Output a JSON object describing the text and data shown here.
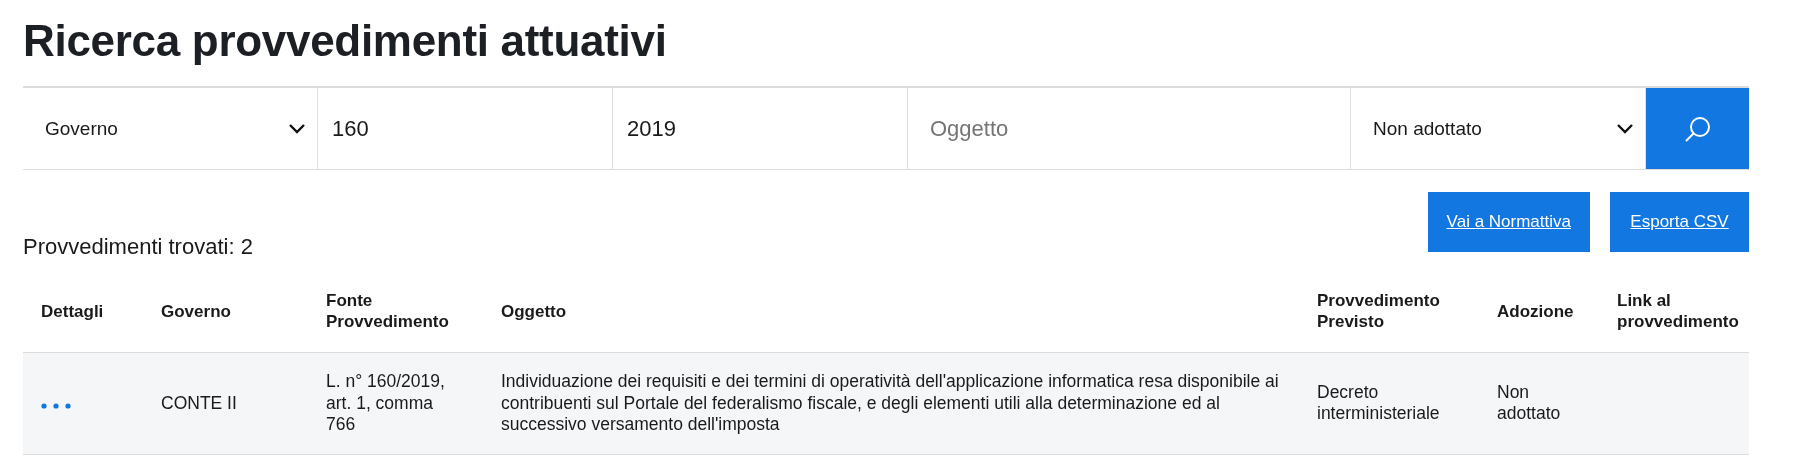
{
  "title": "Ricerca provvedimenti attuativi",
  "filters": [
    {
      "kind": "select",
      "value": "Governo"
    },
    {
      "kind": "input",
      "value": "160"
    },
    {
      "kind": "input",
      "value": "2019"
    },
    {
      "kind": "input",
      "placeholder": "Oggetto"
    },
    {
      "kind": "select",
      "value": "Non adottato"
    }
  ],
  "actions": [
    "Vai a Normattiva",
    "Esporta CSV"
  ],
  "results_count": "Provvedimenti trovati: 2",
  "table": {
    "columns": [
      "Dettagli",
      "Governo",
      "Fonte Provvedimento",
      "Oggetto",
      "Provvedimento Previsto",
      "Adozione",
      "Link al provvedimento"
    ],
    "rows": [
      {
        "governo": "CONTE II",
        "fonte": "L. n° 160/2019, art. 1, comma 766",
        "oggetto": "Individuazione dei requisiti e dei termini di operatività dell'applicazione informatica resa disponibile ai contribuenti sul Portale del federalismo fiscale, e degli elementi utili alla determinazione ed al successivo versamento dell'imposta",
        "previsto": "Decreto interministeriale",
        "adozione": "Non adottato"
      }
    ]
  }
}
